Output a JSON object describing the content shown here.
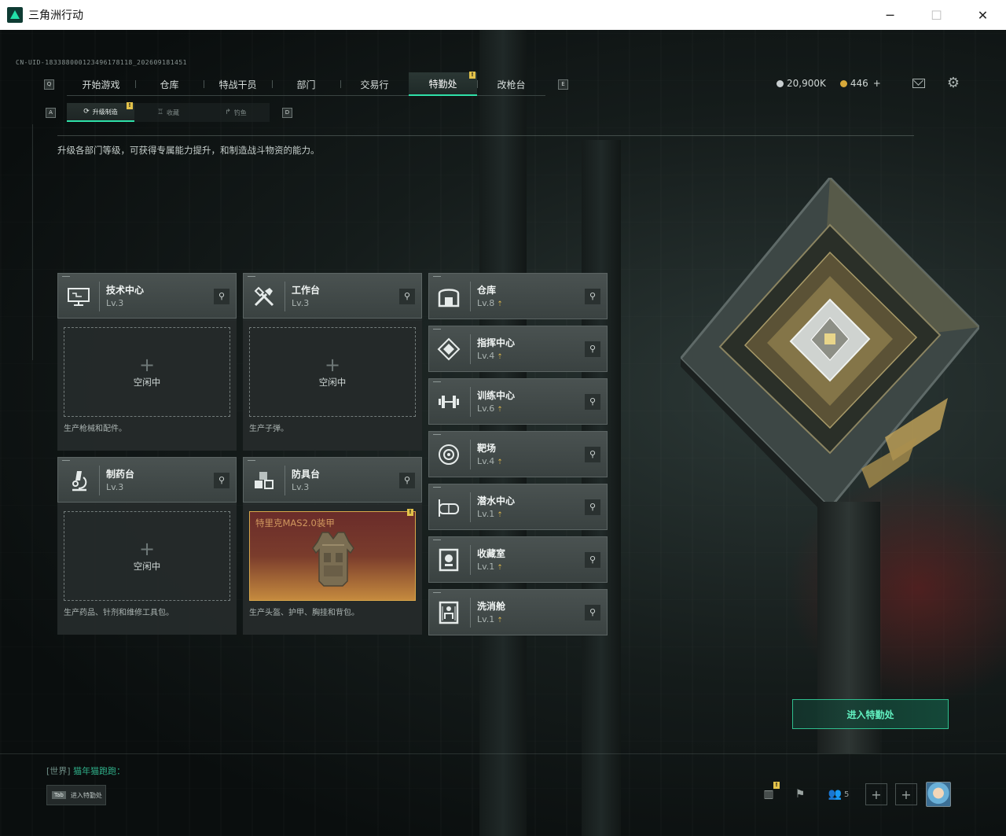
{
  "window": {
    "title": "三角洲行动",
    "minimize": "─",
    "maximize": "☐",
    "close": "✕"
  },
  "cuid": "CN-UID-18338800012349617811​8_202609181451",
  "main_nav": {
    "left_key": "Q",
    "right_key": "E",
    "tabs": [
      {
        "label": "开始游戏"
      },
      {
        "label": "仓库"
      },
      {
        "label": "特战干员"
      },
      {
        "label": "部门"
      },
      {
        "label": "交易行"
      },
      {
        "label": "特勤处",
        "active": true,
        "badge": "!"
      },
      {
        "label": "改枪台"
      }
    ]
  },
  "currency": {
    "silver": "20,900K",
    "gold": "446",
    "gold_plus": "+"
  },
  "sub_nav": {
    "left_key": "A",
    "right_key": "D",
    "tabs": [
      {
        "label": "升级制造",
        "active": true,
        "badge": "!"
      },
      {
        "label": "收藏"
      },
      {
        "label": "钓鱼"
      }
    ]
  },
  "description": "升级各部门等级，可获得专属能力提升，和制造战斗物资的能力。",
  "workstations": [
    {
      "name": "技术中心",
      "level": "Lv.3",
      "status": "空闲中",
      "desc": "生产枪械和配件。",
      "icon": "computer-icon"
    },
    {
      "name": "工作台",
      "level": "Lv.3",
      "status": "空闲中",
      "desc": "生产子弹。",
      "icon": "tools-icon"
    },
    {
      "name": "制药台",
      "level": "Lv.3",
      "status": "空闲中",
      "desc": "生产药品、针剂和维修工具包。",
      "icon": "microscope-icon"
    },
    {
      "name": "防具台",
      "level": "Lv.3",
      "product": "特里克MAS2.0装甲",
      "badge": "!",
      "desc": "生产头盔、护甲、胸挂和背包。",
      "icon": "armor-blocks-icon"
    }
  ],
  "rooms": [
    {
      "name": "仓库",
      "level": "Lv.8",
      "icon": "warehouse-icon"
    },
    {
      "name": "指挥中心",
      "level": "Lv.4",
      "icon": "command-diamond-icon"
    },
    {
      "name": "训练中心",
      "level": "Lv.6",
      "icon": "dumbbell-icon"
    },
    {
      "name": "靶场",
      "level": "Lv.4",
      "icon": "target-icon"
    },
    {
      "name": "潜水中心",
      "level": "Lv.1",
      "icon": "diving-mask-icon"
    },
    {
      "name": "收藏室",
      "level": "Lv.1",
      "icon": "collection-icon"
    },
    {
      "name": "洗消舱",
      "level": "Lv.1",
      "icon": "decon-icon"
    }
  ],
  "enter_button": "进入特勤处",
  "chat": {
    "channel": "[世界]",
    "message": "猫年猫跑跑："
  },
  "tab_hint": {
    "key": "Tab",
    "label": "进入特勤处"
  },
  "bottom_bar": {
    "stats_badge": "!",
    "friend_count": "5",
    "add1": "+",
    "add2": "+"
  },
  "colors": {
    "accent": "#2fe0a8",
    "badge": "#e3c24a",
    "upgrade_arrow": "#d9b44a"
  }
}
